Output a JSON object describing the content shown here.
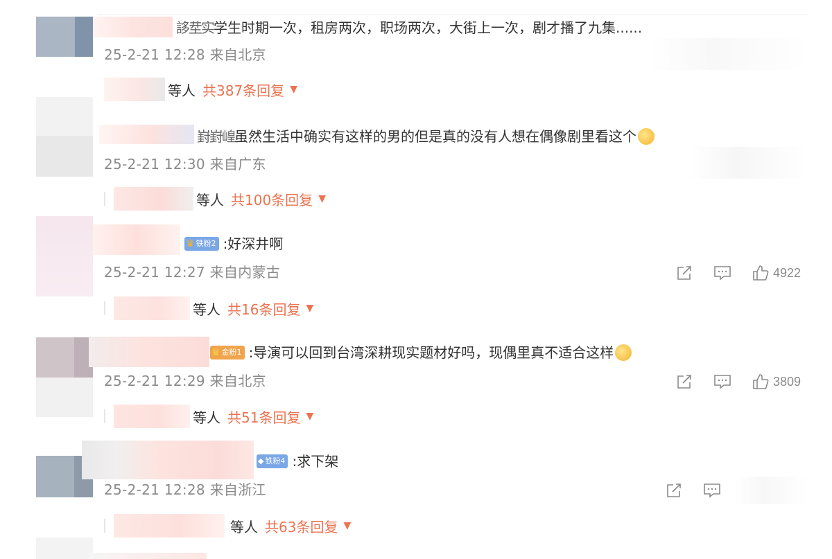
{
  "comments": [
    {
      "prefix": "誃坓实",
      "text": "学生时期一次，租房两次，职场两次，大街上一次，剧才播了九集......",
      "meta": "25-2-21 12:28 来自北京",
      "reply_suffix": "等人",
      "reply_count": "共387条回复"
    },
    {
      "prefix": "崶崶崲",
      "text": "虽然生活中确实有这样的男的但是真的没有人想在偶像剧里看这个",
      "meta": "25-2-21 12:30 来自广东",
      "reply_suffix": "等人",
      "reply_count": "共100条回复"
    },
    {
      "badge": "铁粉2",
      "text": ":好深井啊",
      "meta": "25-2-21 12:27 来自内蒙古",
      "likes": "4922",
      "reply_suffix": "等人",
      "reply_count": "共16条回复"
    },
    {
      "badge": "金粉1",
      "text": ":导演可以回到台湾深耕现实题材好吗，现偶里真不适合这样",
      "meta": "25-2-21 12:29 来自北京",
      "likes": "3809",
      "reply_suffix": "等人",
      "reply_count": "共51条回复"
    },
    {
      "badge": "铁粉4",
      "text": ":求下架",
      "meta": "25-2-21 12:28 来自浙江",
      "reply_suffix": "等人",
      "reply_count": "共63条回复"
    }
  ],
  "icons": {
    "share": "share-icon",
    "comment": "comment-icon",
    "like": "like-icon",
    "caret": "caret-down-icon",
    "emoji": "laugh-cry-emoji-icon"
  },
  "colors": {
    "accent": "#eb7350",
    "meta": "#8a8a8a",
    "text": "#333333",
    "badge_iron": "#7aa7e6",
    "badge_gold": "#f0a44b"
  }
}
